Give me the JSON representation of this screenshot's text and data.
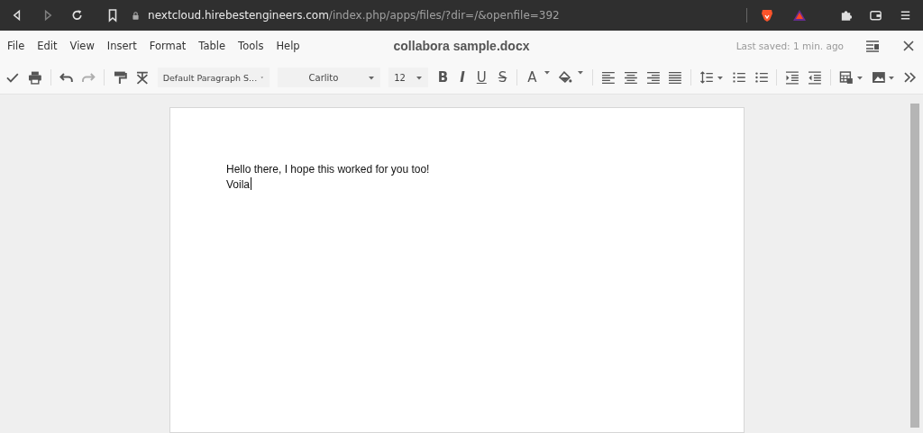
{
  "browser": {
    "url_host": "nextcloud.hirebestengineers.com",
    "url_path": "/index.php/apps/files/?dir=/&openfile=392",
    "forward_disabled": true
  },
  "menu": [
    "File",
    "Edit",
    "View",
    "Insert",
    "Format",
    "Table",
    "Tools",
    "Help"
  ],
  "document_title": "collabora sample.docx",
  "last_saved": "Last saved: 1 min. ago",
  "toolbar": {
    "paragraph_style": "Default Paragraph S...",
    "font": "Carlito",
    "font_size": "12",
    "redo_disabled": true,
    "format_buttons": [
      {
        "glyph": "B",
        "kind": "bold"
      },
      {
        "glyph": "I",
        "kind": "italic"
      },
      {
        "glyph": "U",
        "kind": "underline"
      },
      {
        "glyph": "S",
        "kind": "strike"
      }
    ],
    "font_color_glyph": "A"
  },
  "document": {
    "paragraphs": [
      {
        "text": "Hello there, I hope this worked for you too!",
        "cursor": false
      },
      {
        "text": "Voila",
        "cursor": true
      }
    ]
  }
}
